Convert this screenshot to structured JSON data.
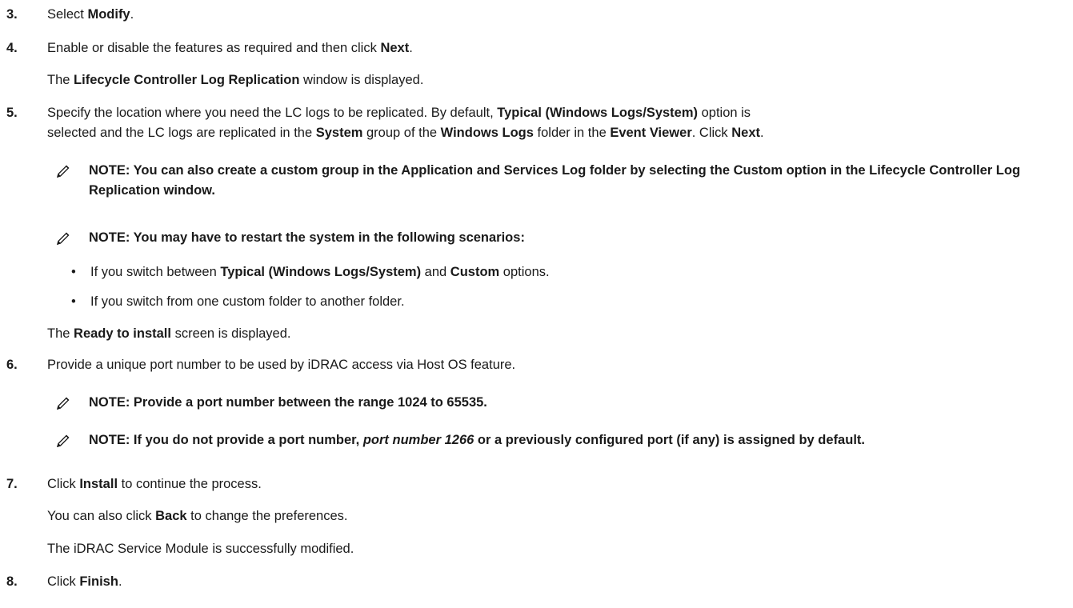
{
  "steps": [
    {
      "num": "3.",
      "pre": "Select ",
      "b1": "Modify",
      "post": "."
    },
    {
      "num": "4.",
      "pre": "Enable or disable the features as required and then click ",
      "b1": "Next",
      "post": ".",
      "sub_pre": "The ",
      "sub_b": "Lifecycle Controller Log Replication",
      "sub_post": " window is displayed."
    },
    {
      "num": "5.",
      "l1_pre": "Specify the location where you need the LC logs to be replicated. By default, ",
      "l1_b": "Typical (Windows Logs/System)",
      "l1_post": " option is",
      "l2_pre": "selected and the LC logs are replicated in the ",
      "l2_b1": "System",
      "l2_mid1": " group of the ",
      "l2_b2": "Windows Logs",
      "l2_mid2": " folder in the ",
      "l2_b3": "Event Viewer",
      "l2_mid3": ". Click ",
      "l2_b4": "Next",
      "l2_post": ".",
      "note1": "NOTE: You can also create a custom group in the Application and Services Log folder by selecting the Custom option in the Lifecycle Controller Log Replication window.",
      "note2": "NOTE: You may have to restart the system in the following scenarios:",
      "bullet1_pre": "If you switch between ",
      "bullet1_b1": "Typical (Windows Logs/System)",
      "bullet1_mid": " and ",
      "bullet1_b2": "Custom",
      "bullet1_post": " options.",
      "bullet2": "If you switch from one custom folder to another folder.",
      "sub_pre": "The ",
      "sub_b": "Ready to install",
      "sub_post": " screen is displayed."
    },
    {
      "num": "6.",
      "text": "Provide a unique port number to be used by iDRAC access via Host OS feature.",
      "note1": "NOTE: Provide a port number between the range 1024 to 65535.",
      "note2_pre": "NOTE: If you do not provide a port number, ",
      "note2_i": "port number 1266",
      "note2_post": " or a previously configured port (if any) is assigned by default."
    },
    {
      "num": "7.",
      "pre": "Click ",
      "b1": "Install",
      "post": " to continue the process.",
      "sub1_pre": "You can also click ",
      "sub1_b": "Back",
      "sub1_post": " to change the preferences.",
      "sub2": "The iDRAC Service Module is successfully modified."
    },
    {
      "num": "8.",
      "pre": "Click ",
      "b1": "Finish",
      "post": "."
    }
  ],
  "bullet_char": "•",
  "icons": {
    "note": "note-pencil-icon"
  }
}
